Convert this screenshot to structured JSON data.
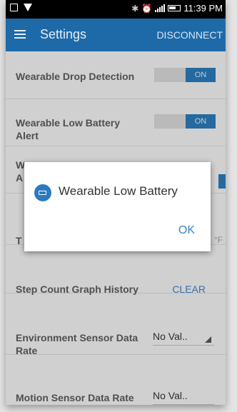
{
  "status_bar": {
    "time": "11:39 PM"
  },
  "app_bar": {
    "title": "Settings",
    "action": "DISCONNECT"
  },
  "settings": [
    {
      "label": "Wearable Drop Detection",
      "toggle_text": "ON"
    },
    {
      "label": "Wearable Low Battery Alert",
      "toggle_text": "ON"
    },
    {
      "label_partial": "W\nA"
    },
    {
      "label_partial": "T",
      "unit_partial": "°F"
    },
    {
      "label": "Step Count Graph History",
      "action": "CLEAR"
    },
    {
      "label": "Environment Sensor Data Rate",
      "value": "No Val.."
    },
    {
      "label": "Motion Sensor Data Rate",
      "value": "No Val.."
    }
  ],
  "dialog": {
    "title": "Wearable Low Battery",
    "ok": "OK"
  }
}
